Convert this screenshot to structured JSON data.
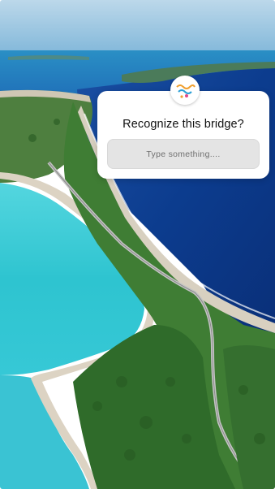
{
  "story": {
    "background_description_icon": "aerial-island-bridge-photo",
    "colors": {
      "ocean_deep": "#0e3d8a",
      "lagoon": "#2fc6d2",
      "land": "#3e7c3a",
      "sand": "#d9cfbf"
    }
  },
  "question_sticker": {
    "avatar_icon": "profile-avatar-icon",
    "title": "Recognize this bridge?",
    "placeholder": "Type something...."
  }
}
